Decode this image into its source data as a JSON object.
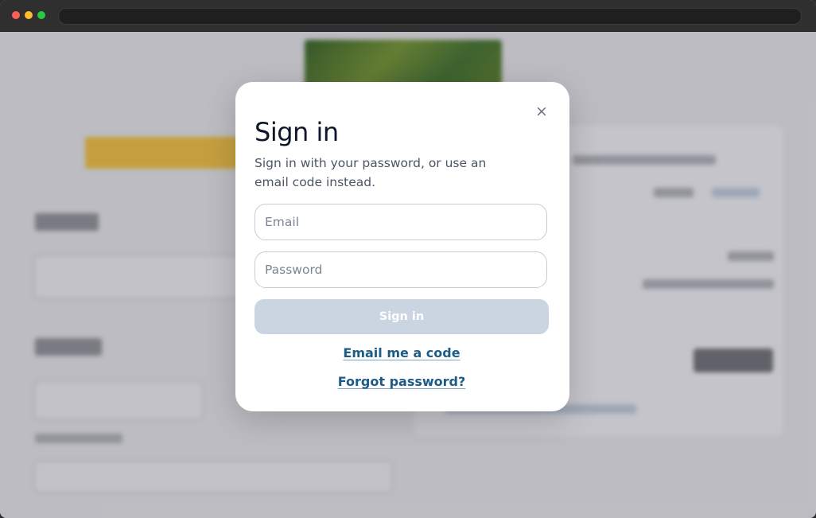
{
  "browser": {
    "controls": [
      "close",
      "minimize",
      "maximize"
    ],
    "address_bar": ""
  },
  "modal": {
    "close_label": "×",
    "title": "Sign in",
    "subtitle": "Sign in with your password, or use an email code instead.",
    "email_placeholder": "Email",
    "password_placeholder": "Password",
    "submit_label": "Sign in",
    "email_code_link": "Email me a code",
    "forgot_link": "Forgot password?",
    "submit_disabled": true
  },
  "colors": {
    "link": "#1d5c86",
    "submit_disabled_bg": "#cbd5e1",
    "title": "#0f172a"
  }
}
